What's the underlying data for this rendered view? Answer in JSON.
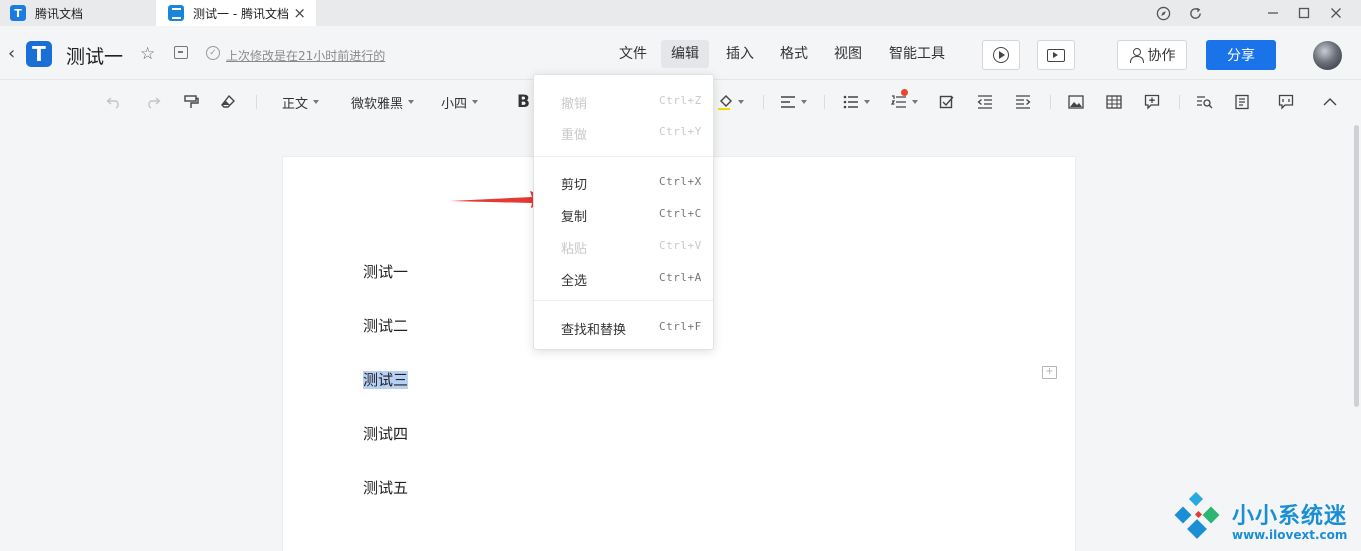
{
  "tabs": [
    {
      "label": "腾讯文档",
      "active": false
    },
    {
      "label": "测试一 - 腾讯文档",
      "active": true
    }
  ],
  "window_controls": [
    "compass-icon",
    "refresh-icon",
    "minimize-icon",
    "maximize-icon",
    "close-icon"
  ],
  "header": {
    "title": "测试一",
    "save_status": "上次修改是在21小时前进行的",
    "menus": [
      "文件",
      "编辑",
      "插入",
      "格式",
      "视图",
      "智能工具"
    ],
    "active_menu": "编辑",
    "collab_label": "协作",
    "share_label": "分享"
  },
  "toolbar": {
    "style": "正文",
    "font": "微软雅黑",
    "size": "小四",
    "bold": "B"
  },
  "edit_menu": {
    "groups": [
      [
        {
          "label": "撤销",
          "shortcut": "Ctrl+Z",
          "enabled": false
        },
        {
          "label": "重做",
          "shortcut": "Ctrl+Y",
          "enabled": false
        }
      ],
      [
        {
          "label": "剪切",
          "shortcut": "Ctrl+X",
          "enabled": true
        },
        {
          "label": "复制",
          "shortcut": "Ctrl+C",
          "enabled": true
        },
        {
          "label": "粘贴",
          "shortcut": "Ctrl+V",
          "enabled": false
        },
        {
          "label": "全选",
          "shortcut": "Ctrl+A",
          "enabled": true
        }
      ],
      [
        {
          "label": "查找和替换",
          "shortcut": "Ctrl+F",
          "enabled": true
        }
      ]
    ]
  },
  "document": {
    "paragraphs": [
      "测试一",
      "测试二",
      "测试三",
      "测试四",
      "测试五"
    ],
    "selected_index": 2
  },
  "annotation": {
    "type": "arrow",
    "color": "#e53935"
  },
  "watermark": {
    "name": "小小系统迷",
    "url": "www.ilovext.com"
  },
  "colors": {
    "accent": "#1a73e8",
    "selection": "#b9d0f5"
  }
}
